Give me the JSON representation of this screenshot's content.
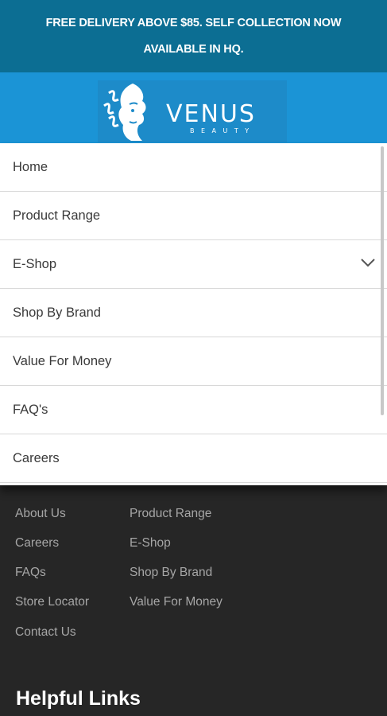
{
  "announcement": {
    "line1": "FREE DELIVERY ABOVE $85. SELF COLLECTION NOW",
    "line2": "AVAILABLE IN HQ."
  },
  "logo": {
    "name": "VENUS",
    "sub": "BEAUTY"
  },
  "menu": {
    "items": [
      {
        "label": "Home"
      },
      {
        "label": "Product Range"
      },
      {
        "label": "E-Shop",
        "icon": "chevron-down-icon"
      },
      {
        "label": "Shop By Brand"
      },
      {
        "label": "Value For Money"
      },
      {
        "label": "FAQ's"
      },
      {
        "label": "Careers"
      }
    ]
  },
  "footer": {
    "col1": [
      "About Us",
      "Careers",
      "FAQs",
      "Store Locator",
      "Contact Us"
    ],
    "col2": [
      "Product Range",
      "E-Shop",
      "Shop By Brand",
      "Value For Money"
    ],
    "helpful_links_heading": "Helpful Links"
  },
  "colors": {
    "announcement_bg": "#0c6e93",
    "logo_band_bg": "#1b94d6",
    "footer_bg": "#262626",
    "footer_link": "#a6a6a6"
  }
}
